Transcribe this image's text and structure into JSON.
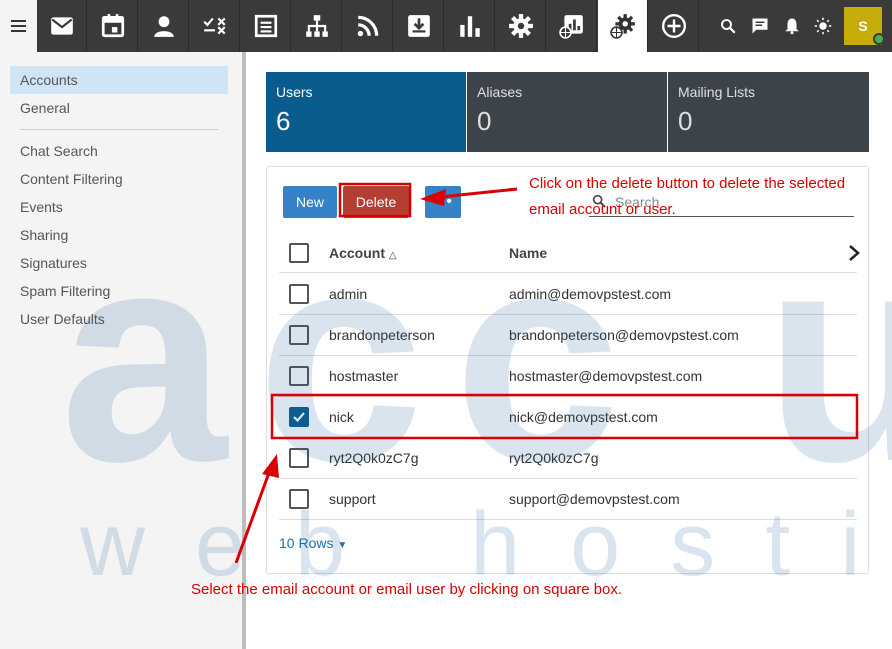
{
  "topbar": {
    "apps": [
      {
        "name": "mail",
        "icon": "envelope-icon"
      },
      {
        "name": "calendar",
        "icon": "calendar-icon"
      },
      {
        "name": "contacts",
        "icon": "person-icon"
      },
      {
        "name": "tasks",
        "icon": "tasks-icon"
      },
      {
        "name": "notes",
        "icon": "notes-icon"
      },
      {
        "name": "sitemap",
        "icon": "sitemap-icon"
      },
      {
        "name": "rss",
        "icon": "rss-icon"
      },
      {
        "name": "archive",
        "icon": "download-box-icon"
      },
      {
        "name": "reports",
        "icon": "bar-chart-icon"
      },
      {
        "name": "settings",
        "icon": "gear-icon"
      },
      {
        "name": "domain-reports",
        "icon": "globe-chart-icon"
      },
      {
        "name": "domain-settings",
        "icon": "globe-gear-icon"
      },
      {
        "name": "add",
        "icon": "plus-circle-icon"
      }
    ],
    "avatar_initial": "S"
  },
  "sidebar": {
    "items": [
      {
        "label": "Accounts",
        "active": true
      },
      {
        "label": "General"
      },
      {
        "label": "Chat Search"
      },
      {
        "label": "Content Filtering"
      },
      {
        "label": "Events"
      },
      {
        "label": "Sharing"
      },
      {
        "label": "Signatures"
      },
      {
        "label": "Spam Filtering"
      },
      {
        "label": "User Defaults"
      }
    ]
  },
  "tiles": [
    {
      "label": "Users",
      "count": "6"
    },
    {
      "label": "Aliases",
      "count": "0"
    },
    {
      "label": "Mailing Lists",
      "count": "0"
    }
  ],
  "toolbar": {
    "new_label": "New",
    "delete_label": "Delete",
    "more_label": "•••",
    "search_placeholder": "Search"
  },
  "table": {
    "headers": {
      "account": "Account",
      "name": "Name"
    },
    "rows": [
      {
        "account": "admin",
        "name": "admin@demovpstest.com",
        "checked": false
      },
      {
        "account": "brandonpeterson",
        "name": "brandonpeterson@demovpstest.com",
        "checked": false
      },
      {
        "account": "hostmaster",
        "name": "hostmaster@demovpstest.com",
        "checked": false
      },
      {
        "account": "nick",
        "name": "nick@demovpstest.com",
        "checked": true
      },
      {
        "account": "ryt2Q0k0zC7g",
        "name": "ryt2Q0k0zC7g",
        "checked": false
      },
      {
        "account": "support",
        "name": "support@demovpstest.com",
        "checked": false
      }
    ],
    "rows_selector": "10 Rows"
  },
  "annotations": {
    "delete_line1": "Click on the delete button to delete the selected",
    "delete_line2": "email account or user.",
    "select_hint": "Select the email account or email user by clicking on square box."
  },
  "watermark": {
    "big": "acc u",
    "small": "web hosting"
  },
  "colors": {
    "accent": "#0a5c8f",
    "button": "#3583c6",
    "delete": "#b53e34",
    "annotation": "#d90000"
  }
}
